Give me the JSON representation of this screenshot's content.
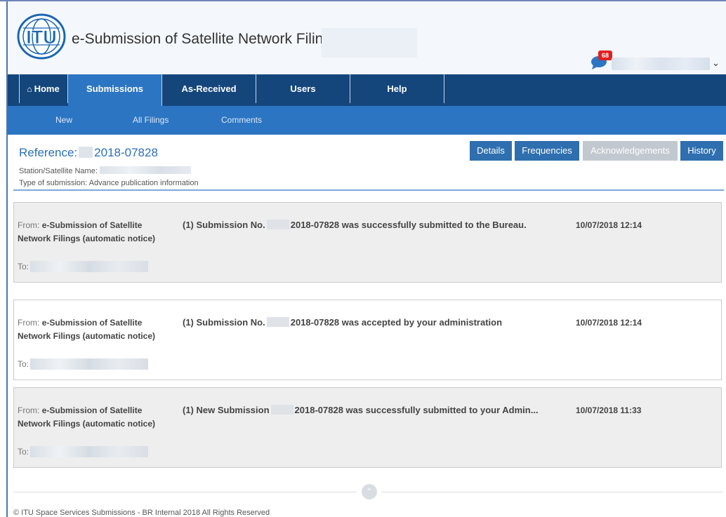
{
  "app": {
    "title": "e-Submission of Satellite Network Filings",
    "logo_text": "ITU",
    "notification_count": "68"
  },
  "nav": {
    "home": "Home",
    "submissions": "Submissions",
    "as_received": "As-Received",
    "users": "Users",
    "help": "Help"
  },
  "subnav": {
    "new": "New",
    "all_filings": "All Filings",
    "comments": "Comments"
  },
  "reference": {
    "label": "Reference:",
    "number": "2018-07828",
    "station_label": "Station/Satellite Name:",
    "type_label": "Type of submission: Advance publication information"
  },
  "tabs": {
    "details": "Details",
    "frequencies": "Frequencies",
    "acknowledgements": "Acknowledgements",
    "history": "History"
  },
  "messages": [
    {
      "from_label": "From:",
      "from_name": "e-Submission of Satellite Network Filings (automatic notice)",
      "to_label": "To:",
      "subject_pre": "(1) Submission No.",
      "subject_post": "2018-07828 was successfully submitted to the Bureau.",
      "date": "10/07/2018 12:14"
    },
    {
      "from_label": "From:",
      "from_name": "e-Submission of Satellite Network Filings (automatic notice)",
      "to_label": "To:",
      "subject_pre": "(1) Submission No.",
      "subject_post": "2018-07828 was accepted by your administration",
      "date": "10/07/2018 12:14"
    },
    {
      "from_label": "From:",
      "from_name": "e-Submission of Satellite Network Filings (automatic notice)",
      "to_label": "To:",
      "subject_pre": "(1) New Submission",
      "subject_post": "2018-07828 was successfully submitted to your Admin...",
      "date": "10/07/2018 11:33"
    }
  ],
  "footer": {
    "copyright": "© ITU Space Services Submissions - BR Internal 2018 All Rights Reserved"
  },
  "colors": {
    "nav_dark": "#14467c",
    "nav_active": "#2c75c2",
    "tab_blue": "#2f6faf",
    "tab_disabled": "#c2c8d0",
    "badge_red": "#e02020"
  }
}
